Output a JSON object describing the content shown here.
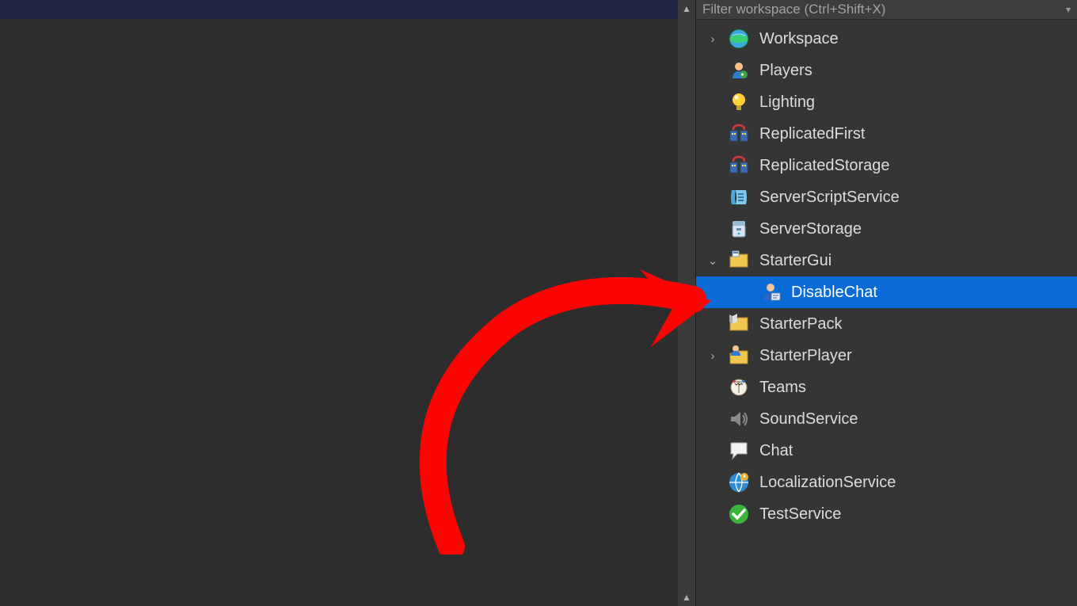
{
  "filter": {
    "placeholder": "Filter workspace (Ctrl+Shift+X)"
  },
  "tree": {
    "items": [
      {
        "label": "Workspace",
        "icon": "workspace",
        "expander": "closed",
        "indent": 0,
        "selected": false
      },
      {
        "label": "Players",
        "icon": "players",
        "expander": "none",
        "indent": 0,
        "selected": false
      },
      {
        "label": "Lighting",
        "icon": "lighting",
        "expander": "none",
        "indent": 0,
        "selected": false
      },
      {
        "label": "ReplicatedFirst",
        "icon": "replicated",
        "expander": "none",
        "indent": 0,
        "selected": false
      },
      {
        "label": "ReplicatedStorage",
        "icon": "replicated",
        "expander": "none",
        "indent": 0,
        "selected": false
      },
      {
        "label": "ServerScriptService",
        "icon": "script-svc",
        "expander": "none",
        "indent": 0,
        "selected": false
      },
      {
        "label": "ServerStorage",
        "icon": "storage",
        "expander": "none",
        "indent": 0,
        "selected": false
      },
      {
        "label": "StarterGui",
        "icon": "folder-gui",
        "expander": "open",
        "indent": 0,
        "selected": false
      },
      {
        "label": "DisableChat",
        "icon": "localscript",
        "expander": "none",
        "indent": 1,
        "selected": true
      },
      {
        "label": "StarterPack",
        "icon": "folder-pack",
        "expander": "none",
        "indent": 0,
        "selected": false
      },
      {
        "label": "StarterPlayer",
        "icon": "folder-ply",
        "expander": "closed",
        "indent": 0,
        "selected": false
      },
      {
        "label": "Teams",
        "icon": "teams",
        "expander": "none",
        "indent": 0,
        "selected": false
      },
      {
        "label": "SoundService",
        "icon": "sound",
        "expander": "none",
        "indent": 0,
        "selected": false
      },
      {
        "label": "Chat",
        "icon": "chat",
        "expander": "none",
        "indent": 0,
        "selected": false
      },
      {
        "label": "LocalizationService",
        "icon": "localize",
        "expander": "none",
        "indent": 0,
        "selected": false
      },
      {
        "label": "TestService",
        "icon": "test",
        "expander": "none",
        "indent": 0,
        "selected": false
      }
    ]
  }
}
